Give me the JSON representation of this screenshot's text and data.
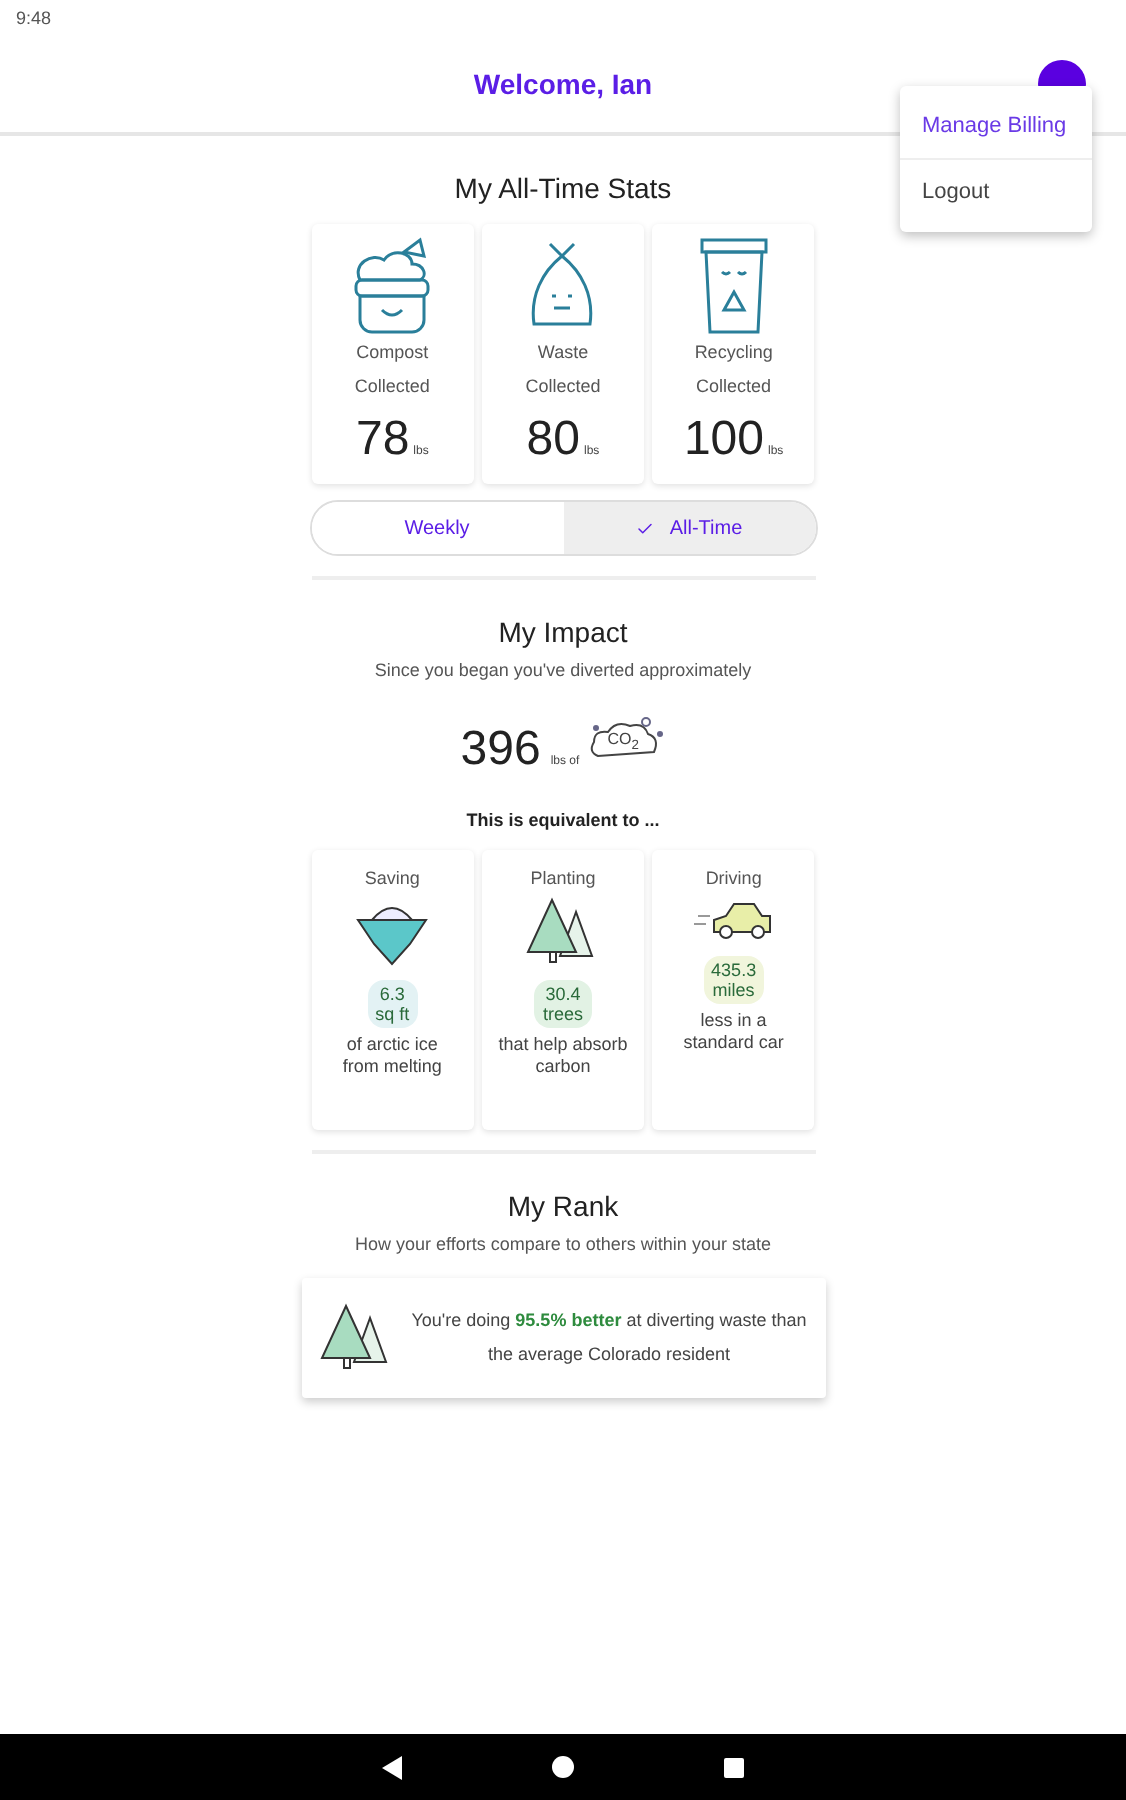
{
  "status_bar": {
    "time": "9:48"
  },
  "header": {
    "title": "Welcome, Ian"
  },
  "menu": {
    "items": [
      {
        "label": "Manage Billing",
        "selected": true
      },
      {
        "label": "Logout",
        "selected": false
      }
    ]
  },
  "stats": {
    "title": "My All-Time Stats",
    "cards": [
      {
        "kind": "compost",
        "label": "Compost",
        "sublabel": "Collected",
        "value": "78",
        "unit": "lbs"
      },
      {
        "kind": "waste",
        "label": "Waste",
        "sublabel": "Collected",
        "value": "80",
        "unit": "lbs"
      },
      {
        "kind": "recycling",
        "label": "Recycling",
        "sublabel": "Collected",
        "value": "100",
        "unit": "lbs"
      }
    ],
    "tabs": [
      {
        "label": "Weekly",
        "selected": false
      },
      {
        "label": "All-Time",
        "selected": true
      }
    ]
  },
  "impact": {
    "title": "My Impact",
    "subtitle": "Since you began you've diverted approximately",
    "value": "396",
    "unit": "lbs of",
    "gas": "CO$_{2}$",
    "equivalent": "This is equivalent to ...",
    "cards": [
      {
        "kind": "ice",
        "heading": "Saving",
        "amount": "6.3\nsq ft",
        "color": "#e3f2f4",
        "caption": "of arctic ice from melting"
      },
      {
        "kind": "trees",
        "heading": "Planting",
        "amount": "30.4\ntrees",
        "color": "#e2f2e4",
        "caption": "that help absorb carbon"
      },
      {
        "kind": "car",
        "heading": "Driving",
        "amount": "435.3\nmiles",
        "color": "#f1f5dc",
        "caption": "less in a standard car"
      }
    ]
  },
  "rank": {
    "title": "My Rank",
    "subtitle": "How your efforts compare to others within your state",
    "text": "You're doing **95.5% better** at diverting waste than the average Colorado resident"
  }
}
